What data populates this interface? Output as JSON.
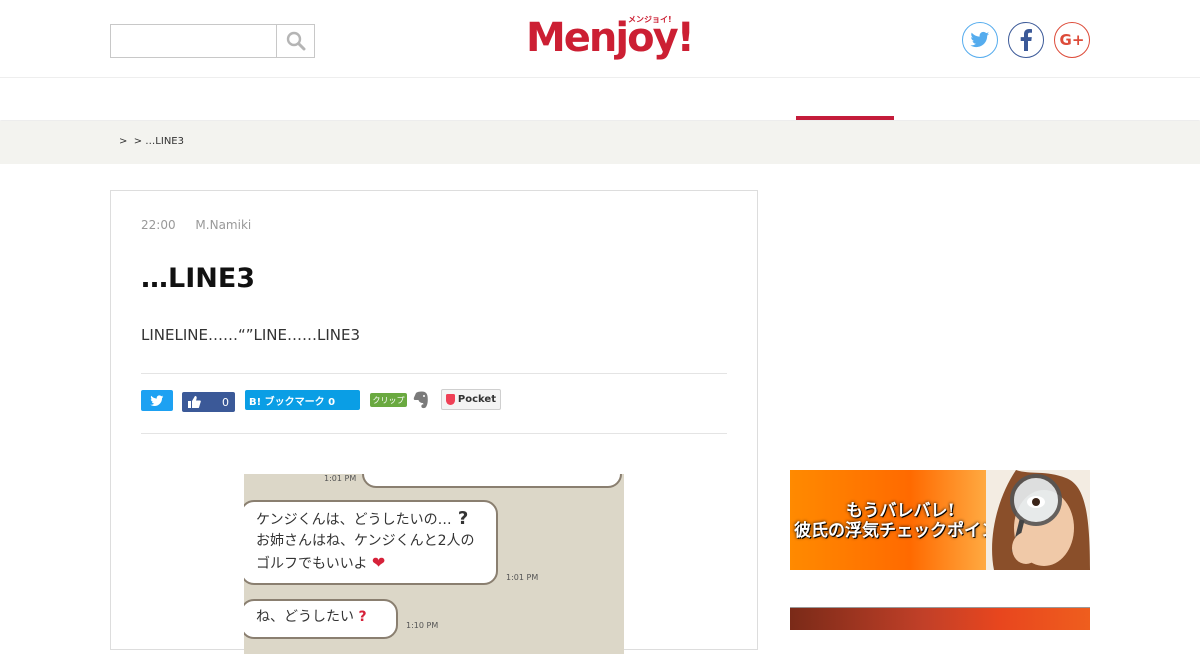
{
  "header": {
    "search": {
      "value": "",
      "placeholder": ""
    },
    "logo": {
      "text": "Menjoy!",
      "kana": "メンジョイ!"
    },
    "social": {
      "twitter": "twitter-icon",
      "facebook": "facebook-icon",
      "googleplus_label": "G+"
    }
  },
  "breadcrumb": {
    "text": ">  > …LINE3"
  },
  "article": {
    "time": "22:00",
    "author": "M.Namiki",
    "title": "…LINE3",
    "lead": "LINELINE……“”LINE……LINE3",
    "share": {
      "like_count": "0",
      "hatena_label": "B! ブックマーク 0",
      "clip_label": "クリップ",
      "pocket_label": "Pocket"
    },
    "image": {
      "bubble_top": "1:01 PM",
      "bubble1_line1": "ケンジくんは、どうしたいの…",
      "bubble1_line2": "お姉さんはね、ケンジくんと2人の",
      "bubble1_line3": "ゴルフでもいいよ",
      "time2": "1:01 PM",
      "bubble2": "ね、どうしたい",
      "time3": "1:10 PM"
    }
  },
  "sidebar": {
    "ad1": {
      "line1": "もうバレバレ!",
      "line2": "彼氏の浮気チェックポイント"
    }
  },
  "colors": {
    "brand": "#cc1f33",
    "nav_active": "#c41c3a",
    "breadcrumb_bg": "#f3f3ef"
  }
}
